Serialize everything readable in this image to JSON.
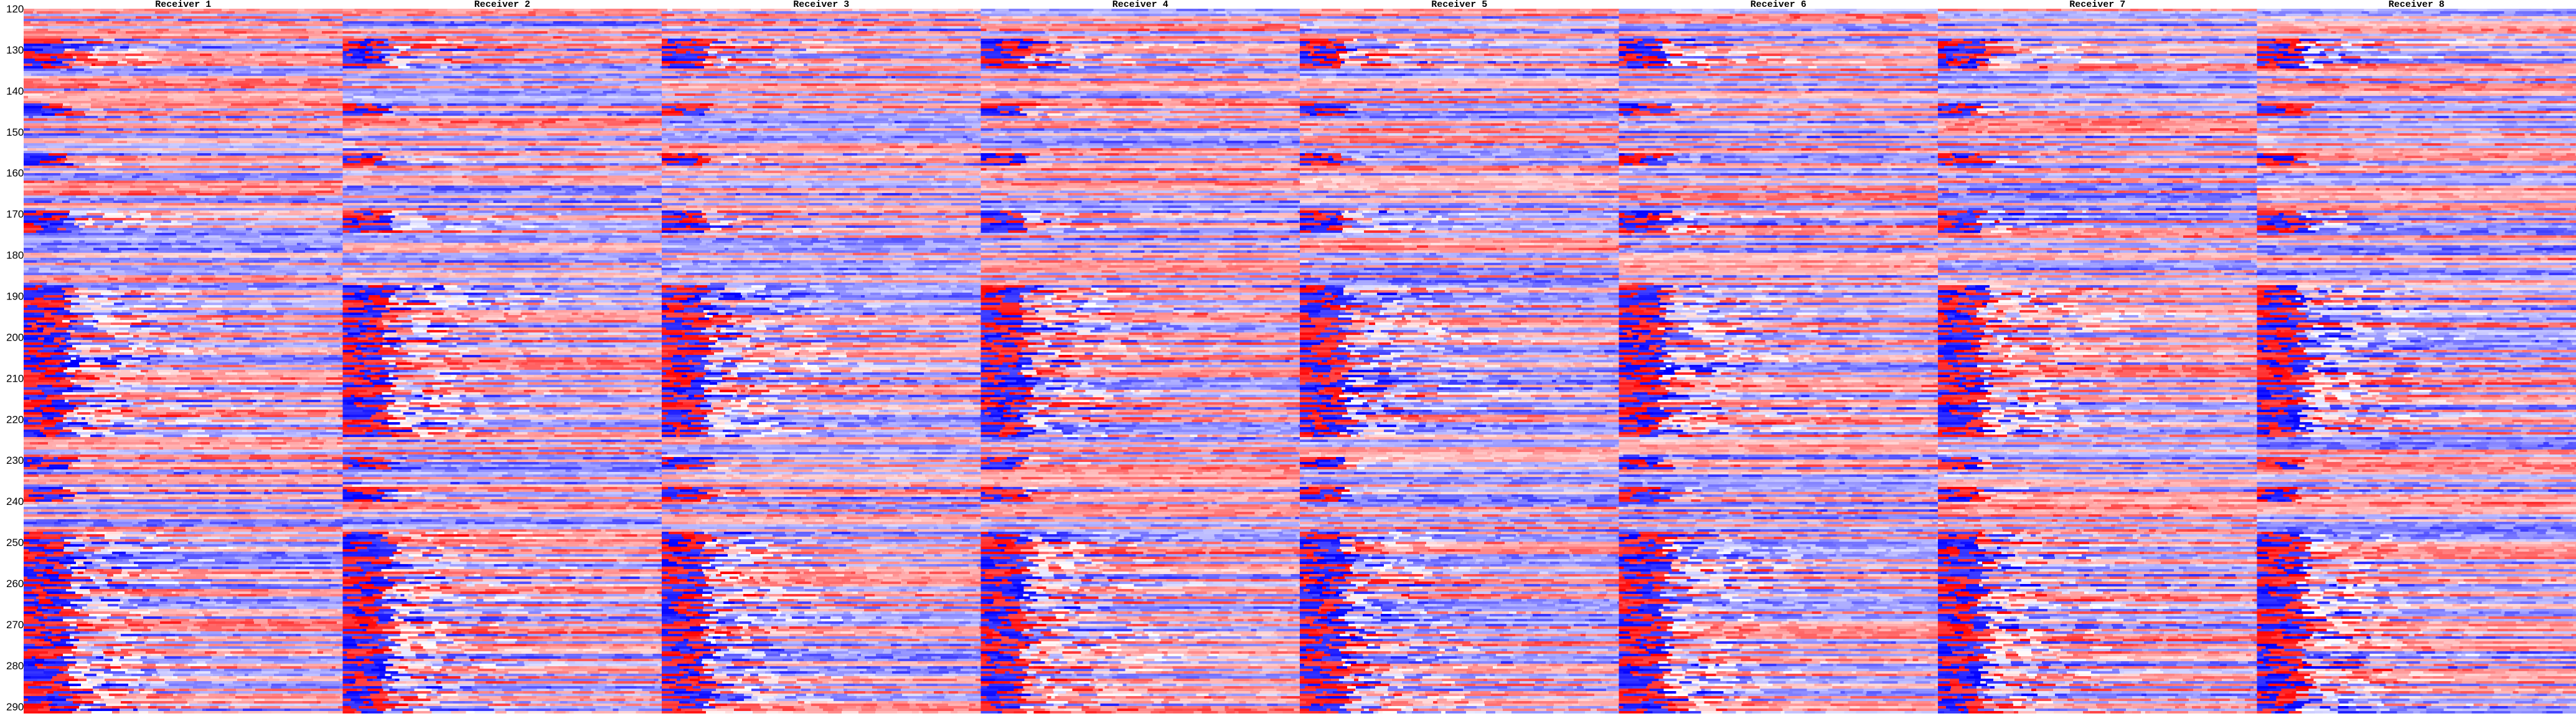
{
  "chart_data": {
    "type": "heatmap",
    "title": "",
    "xlabel": "",
    "ylabel": "",
    "panels": [
      {
        "title": "Receiver 1"
      },
      {
        "title": "Receiver 2"
      },
      {
        "title": "Receiver 3"
      },
      {
        "title": "Receiver 4"
      },
      {
        "title": "Receiver 5"
      },
      {
        "title": "Receiver 6"
      },
      {
        "title": "Receiver 7"
      },
      {
        "title": "Receiver 8"
      }
    ],
    "y_ticks": [
      120,
      130,
      140,
      150,
      160,
      170,
      180,
      190,
      200,
      210,
      220,
      230,
      240,
      250,
      260,
      270,
      280,
      290
    ],
    "ylim": [
      120,
      292
    ],
    "colormap": {
      "negative": "#0000ff",
      "zero": "#ffffff",
      "positive": "#ff0000"
    },
    "high_energy_bands": [
      {
        "from": 127,
        "to": 134,
        "level": 0.9
      },
      {
        "from": 143,
        "to": 146,
        "level": 0.6
      },
      {
        "from": 155,
        "to": 158,
        "level": 0.6
      },
      {
        "from": 169,
        "to": 174,
        "level": 0.8
      },
      {
        "from": 187,
        "to": 224,
        "level": 1.0
      },
      {
        "from": 229,
        "to": 232,
        "level": 0.6
      },
      {
        "from": 236,
        "to": 240,
        "level": 0.7
      },
      {
        "from": 247,
        "to": 292,
        "level": 0.95
      }
    ],
    "grid": false,
    "legend": "none"
  }
}
